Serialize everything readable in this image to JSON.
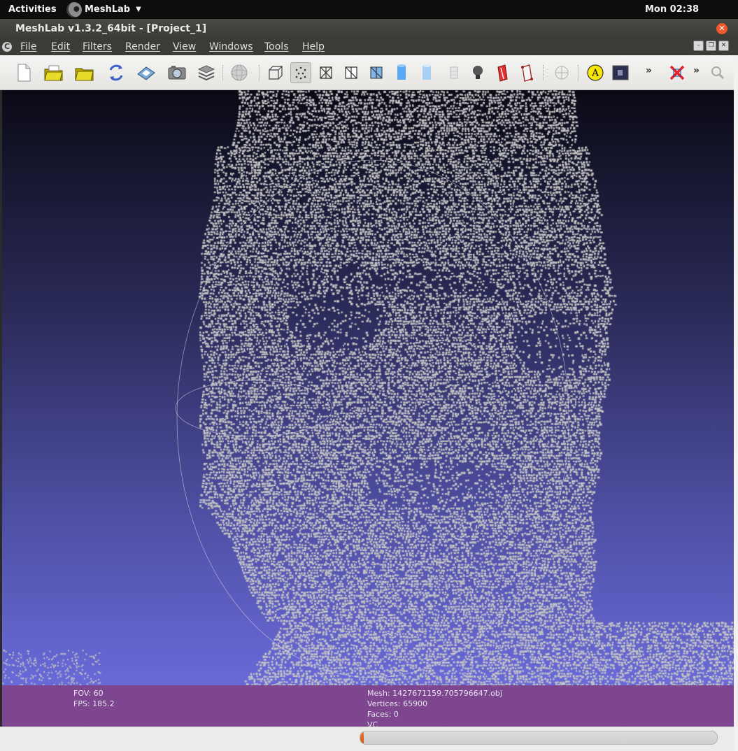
{
  "topbar": {
    "activities": "Activities",
    "app_name": "MeshLab",
    "clock": "Mon 02:38"
  },
  "window": {
    "title": "MeshLab v1.3.2_64bit - [Project_1]"
  },
  "menu": {
    "items": [
      "File",
      "Edit",
      "Filters",
      "Render",
      "View",
      "Windows",
      "Tools",
      "Help"
    ]
  },
  "toolbar": {
    "icons": [
      "new-document-icon",
      "open-folder-icon",
      "open-project-icon",
      "reload-icon",
      "save-snapshot-icon",
      "camera-snapshot-icon",
      "layers-icon",
      "sphere-icon",
      "bounding-box-icon",
      "points-icon",
      "wireframe-icon",
      "hidden-lines-icon",
      "flat-lines-icon",
      "flat-shading-icon",
      "smooth-shading-icon",
      "texture-icon",
      "light-icon",
      "color-icon",
      "double-side-icon",
      "mesh-globe-icon",
      "annotation-icon",
      "raster-icon",
      "delete-icon",
      "search-icon"
    ],
    "selected": "points-icon",
    "annotation_letter": "A",
    "overflow_marker": "»"
  },
  "viewport": {
    "fov_label": "FOV: 60",
    "fps_label": "FPS:   185.2",
    "mesh_label": "Mesh: 1427671159.705796647.obj",
    "vertices_label": "Vertices: 65900",
    "faces_label": "Faces: 0",
    "vc_label": "VC",
    "colors": {
      "point": "#c4c4c4",
      "bg_top": "#0a0a16",
      "bg_bottom": "#7070e6",
      "info_bg": "#804080"
    }
  },
  "status": {
    "progress": 0.01
  }
}
